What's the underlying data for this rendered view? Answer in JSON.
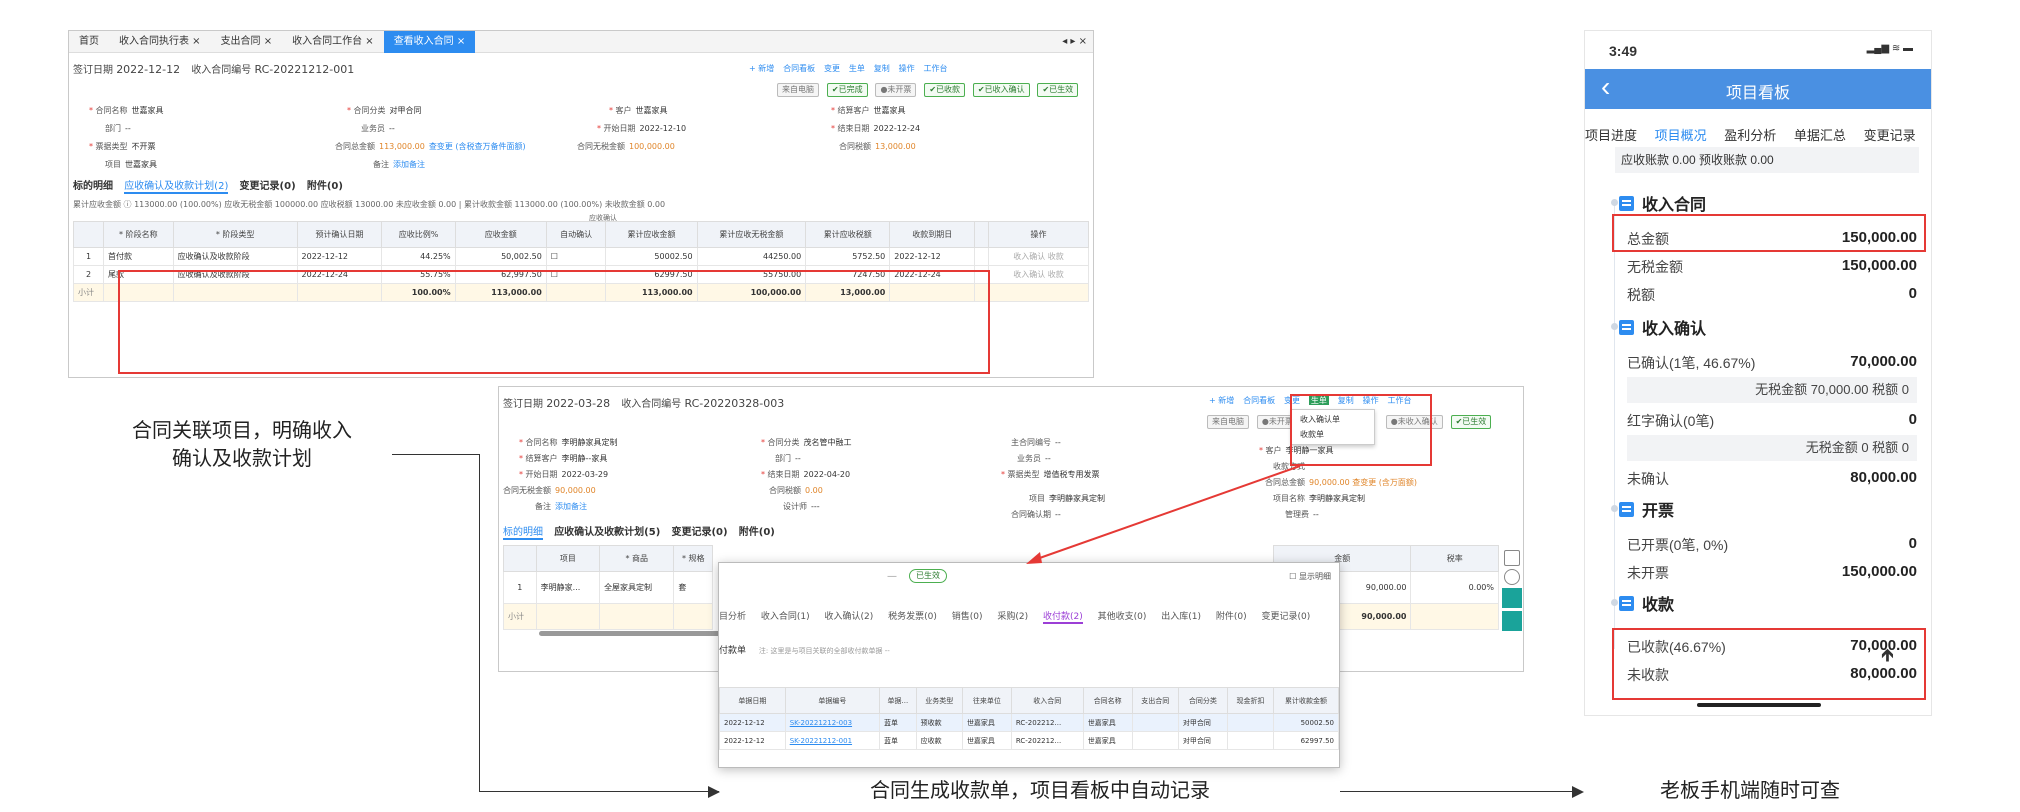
{
  "screen1": {
    "tabs": [
      "首页",
      "收入合同执行表 ×",
      "支出合同 ×",
      "收入合同工作台 ×",
      "查看收入合同 ×"
    ],
    "nav": "◂ ▸ ×",
    "sign_label": "签订日期",
    "sign_date": "2022-12-12",
    "no_label": "收入合同编号",
    "no_value": "RC-20221212-001",
    "toolbar": [
      "+ 新增",
      "合同看板",
      "变更",
      "生单",
      "复制",
      "操作",
      "工作台"
    ],
    "chips": [
      "来自电脑",
      "✔已完成",
      "●未开票",
      "✔已收款",
      "✔已收入确认",
      "✔已生效"
    ],
    "fields": [
      {
        "label": "合同名称",
        "value": "世嘉家具",
        "req": true
      },
      {
        "label": "合同分类",
        "value": "对甲合同",
        "req": true
      },
      {
        "label": "客户",
        "value": "世嘉家具",
        "req": true
      },
      {
        "label": "结算客户",
        "value": "世嘉家具",
        "req": true
      },
      {
        "label": "部门",
        "value": "--",
        "req": false
      },
      {
        "label": "业务员",
        "value": "--",
        "req": false
      },
      {
        "label": "开始日期",
        "value": "2022-12-10",
        "req": true
      },
      {
        "label": "结束日期",
        "value": "2022-12-24",
        "req": true
      },
      {
        "label": "票据类型",
        "value": "不开票",
        "req": true
      },
      {
        "label": "合同总金额",
        "value": "113,000.00",
        "req": false,
        "extra": "查变更 (含税查万备件面额)"
      },
      {
        "label": "合同无税金额",
        "value": "100,000.00",
        "req": false
      },
      {
        "label": "合同税额",
        "value": "13,000.00",
        "req": false
      },
      {
        "label": "项目",
        "value": "世嘉家具",
        "req": false
      },
      {
        "label": "备注",
        "value": "添加备注",
        "req": false
      }
    ],
    "subtabs": [
      "标的明细",
      "应收确认及收款计划(2)",
      "变更记录(0)",
      "附件(0)"
    ],
    "summary": "累计应收金额 ⓘ 113000.00 (100.00%)  应收无税金额 100000.00  应收税额 13000.00  未应收金额 0.00  |  累计收款金额 113000.00 (100.00%)  未收款金额 0.00",
    "group_header": "应收确认",
    "headers": [
      "",
      "* 阶段名称",
      "* 阶段类型",
      "预计确认日期",
      "应收比例%",
      "应收金额",
      "自动确认",
      "累计应收金额",
      "累计应收无税金额",
      "累计应收税额",
      "收款到期日",
      "",
      "操作"
    ],
    "rows": [
      [
        "1",
        "首付款",
        "应收确认及收款阶段",
        "2022-12-12",
        "44.25%",
        "50,002.50",
        "☐",
        "50002.50",
        "44250.00",
        "5752.50",
        "2022-12-12",
        "",
        "收入确认  收款"
      ],
      [
        "2",
        "尾款",
        "应收确认及收款阶段",
        "2022-12-24",
        "55.75%",
        "62,997.50",
        "☐",
        "62997.50",
        "55750.00",
        "7247.50",
        "2022-12-24",
        "",
        "收入确认  收款"
      ]
    ],
    "subtotal": [
      "小计",
      "",
      "",
      "",
      "100.00%",
      "113,000.00",
      "",
      "113,000.00",
      "100,000.00",
      "13,000.00",
      "",
      "",
      ""
    ]
  },
  "screen2": {
    "sign_label": "签订日期",
    "sign_date": "2022-03-28",
    "no_label": "收入合同编号",
    "no_value": "RC-20220328-003",
    "toolbar": [
      "+ 新增",
      "合同看板",
      "变更",
      "生单",
      "复制",
      "操作",
      "工作台"
    ],
    "chips": [
      "来自电脑",
      "●未开票",
      "●未收入确认",
      "✔已生效"
    ],
    "dropdown": [
      "收入确认单",
      "收款单"
    ],
    "fields": [
      {
        "label": "合同名称",
        "value": "李明静家具定制",
        "req": true
      },
      {
        "label": "合同分类",
        "value": "茂名管中融工",
        "req": true
      },
      {
        "label": "主合同编号",
        "value": "--",
        "req": false
      },
      {
        "label": "客户",
        "value": "李明静一家具",
        "req": true
      },
      {
        "label": "结算客户",
        "value": "李明静--家具",
        "req": true
      },
      {
        "label": "部门",
        "value": "--",
        "req": false
      },
      {
        "label": "业务员",
        "value": "--",
        "req": false
      },
      {
        "label": "收款方式",
        "value": "",
        "req": false
      },
      {
        "label": "开始日期",
        "value": "2022-03-29",
        "req": true
      },
      {
        "label": "结束日期",
        "value": "2022-04-20",
        "req": true
      },
      {
        "label": "票据类型",
        "value": "增值税专用发票",
        "req": true
      },
      {
        "label": "合同总金额",
        "value": "90,000.00 查变更 (含万面额)",
        "req": false
      },
      {
        "label": "合同无税金额",
        "value": "90,000.00",
        "req": false
      },
      {
        "label": "合同税额",
        "value": "0.00",
        "req": false
      },
      {
        "label": "项目",
        "value": "李明静家具定制",
        "req": false
      },
      {
        "label": "项目名称",
        "value": "李明静家具定制",
        "req": false
      },
      {
        "label": "备注",
        "value": "添加备注",
        "req": false
      },
      {
        "label": "设计师",
        "value": "---",
        "req": false
      },
      {
        "label": "合同确认期",
        "value": "--",
        "req": false
      },
      {
        "label": "管理费",
        "value": "--",
        "req": false
      }
    ],
    "subtabs": [
      "标的明细",
      "应收确认及收款计划(5)",
      "变更记录(0)",
      "附件(0)"
    ],
    "headers": [
      "",
      "项目",
      "* 商品",
      "* 规格"
    ],
    "row": [
      "1",
      "李明静家...",
      "全屋家具定制",
      "套"
    ],
    "right_headers": [
      "金额",
      "税率"
    ],
    "right_row": [
      "90,000.00",
      "0.00%"
    ],
    "right_sub": "90,000.00",
    "subtotal": "小计"
  },
  "popup": {
    "badge": "已生效",
    "check": "显示明细",
    "tabs": [
      "目分析",
      "收入合同(1)",
      "收入确认(2)",
      "税务发票(0)",
      "销售(0)",
      "采购(2)",
      "收付款(2)",
      "其他收支(0)",
      "出入库(1)",
      "附件(0)",
      "变更记录(0)"
    ],
    "note_label": "付款单",
    "note": "注: 这里是与项目关联的全部收付款单据 --",
    "headers": [
      "单据日期",
      "单据编号",
      "单据...",
      "业务类型",
      "往来单位",
      "收入合同",
      "合同名称",
      "支出合同",
      "合同分类",
      "现金折扣",
      "累计收款金额"
    ],
    "rows": [
      [
        "2022-12-12",
        "SK-20221212-003",
        "蓝单",
        "预收款",
        "世嘉家具",
        "RC-202212...",
        "世嘉家具",
        "",
        "对甲合同",
        "",
        "50002.50"
      ],
      [
        "2022-12-12",
        "SK-20221212-001",
        "蓝单",
        "应收款",
        "世嘉家具",
        "RC-202212...",
        "世嘉家具",
        "",
        "对甲合同",
        "",
        "62997.50"
      ]
    ]
  },
  "annotations": {
    "left": "合同关联项目，明确收入\n确认及收款计划",
    "bottom": "合同生成收款单，项目看板中自动记录",
    "right": "老板手机端随时可查"
  },
  "phone": {
    "time": "3:49",
    "status": "▂▄▆ ≋ ▬",
    "title": "项目看板",
    "back": "‹",
    "tabs": [
      "项目进度",
      "项目概况",
      "盈利分析",
      "单据汇总",
      "变更记录"
    ],
    "active_tab": 1,
    "top_line": "应收账款 0.00 预收账款 0.00",
    "sec_income": "收入合同",
    "total_label": "总金额",
    "total_value": "150,000.00",
    "notax_label": "无税金额",
    "notax_value": "150,000.00",
    "tax_label": "税额",
    "tax_value": "0",
    "sec_confirm": "收入确认",
    "confirmed_label": "已确认(1笔, 46.67%)",
    "confirmed_value": "70,000.00",
    "confirmed_box": "无税金额 70,000.00 税额 0",
    "red_label": "红字确认(0笔)",
    "red_value": "0",
    "red_box": "无税金额 0 税额 0",
    "unconfirmed_label": "未确认",
    "unconfirmed_value": "80,000.00",
    "sec_invoice": "开票",
    "invoiced_label": "已开票(0笔, 0%)",
    "invoiced_value": "0",
    "uninvoiced_label": "未开票",
    "uninvoiced_value": "150,000.00",
    "sec_receipt": "收款",
    "received_label": "已收款(46.67%)",
    "received_value": "70,000.00",
    "unreceived_label": "未收款",
    "unreceived_value": "80,000.00"
  },
  "colors": {
    "accent": "#2d8cf0",
    "highlight": "#e53935",
    "phone_header": "#4a90e2"
  }
}
